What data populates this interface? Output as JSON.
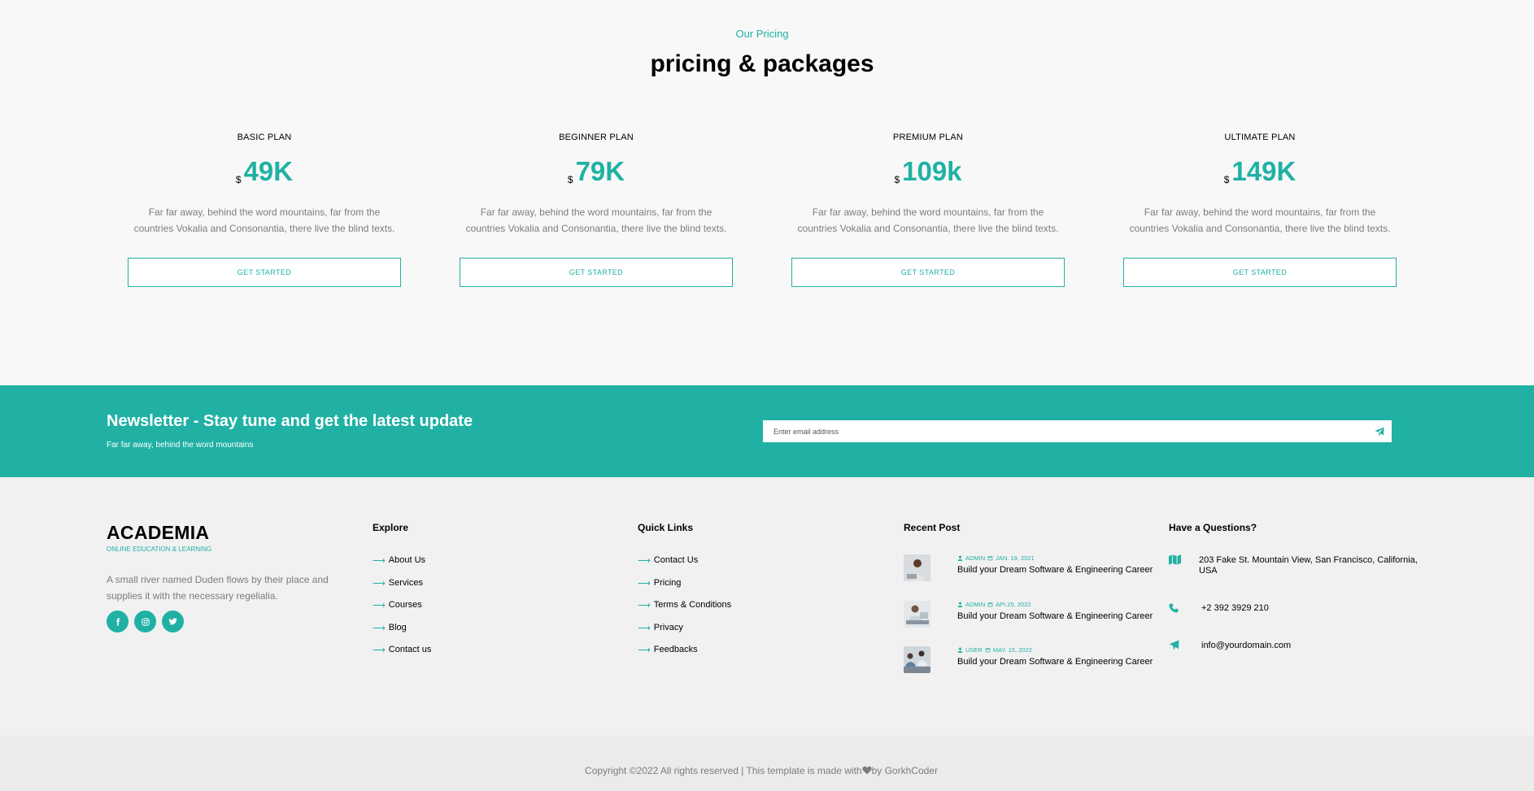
{
  "pricing": {
    "eyebrow": "Our Pricing",
    "title": "pricing & packages",
    "plans": [
      {
        "name": "BASIC PLAN",
        "currency": "$",
        "price": "49K",
        "description": "Far far away, behind the word mountains, far from the countries Vokalia and Consonantia, there live the blind texts.",
        "button": "GET STARTED"
      },
      {
        "name": "BEGINNER PLAN",
        "currency": "$",
        "price": "79K",
        "description": "Far far away, behind the word mountains, far from the countries Vokalia and Consonantia, there live the blind texts.",
        "button": "GET STARTED"
      },
      {
        "name": "PREMIUM PLAN",
        "currency": "$",
        "price": "109k",
        "description": "Far far away, behind the word mountains, far from the countries Vokalia and Consonantia, there live the blind texts.",
        "button": "GET STARTED"
      },
      {
        "name": "ULTIMATE PLAN",
        "currency": "$",
        "price": "149K",
        "description": "Far far away, behind the word mountains, far from the countries Vokalia and Consonantia, there live the blind texts.",
        "button": "GET STARTED"
      }
    ]
  },
  "newsletter": {
    "title": "Newsletter - Stay tune and get the latest update",
    "subtitle": "Far far away, behind the word mountains",
    "placeholder": "Enter email address",
    "send_icon": "paper-plane-icon"
  },
  "footer": {
    "brand": "ACADEMIA",
    "tagline": "ONLINE EDUCATION & LEARNING",
    "about": "A small river named Duden flows by their place and supplies it with the necessary regelialia.",
    "socials": [
      "facebook-icon",
      "instagram-icon",
      "twitter-icon"
    ],
    "explore": {
      "heading": "Explore",
      "links": [
        "About Us",
        "Services",
        "Courses",
        "Blog",
        "Contact us"
      ]
    },
    "quick_links": {
      "heading": "Quick Links",
      "links": [
        "Contact Us",
        "Pricing",
        "Terms & Conditions",
        "Privacy",
        "Feedbacks"
      ]
    },
    "recent_posts": {
      "heading": "Recent Post",
      "posts": [
        {
          "author": "ADMIN",
          "date": "JAN. 19, 2021",
          "title": "Build your Dream Software & Engineering Career"
        },
        {
          "author": "ADMIN",
          "date": "API.25, 2022",
          "title": "Build your Dream Software & Engineering Career"
        },
        {
          "author": "USER",
          "date": "MAY. 15, 2022",
          "title": "Build your Dream Software & Engineering Career"
        }
      ]
    },
    "questions": {
      "heading": "Have a Questions?",
      "address": "203 Fake St. Mountain View, San Francisco, California, USA",
      "phone": "+2 392 3929 210",
      "email": "info@yourdomain.com"
    }
  },
  "copyright": {
    "before": "Copyright ©2022 All rights reserved | This template is made with",
    "after": "by GorkhCoder"
  },
  "colors": {
    "accent": "#20b1a4",
    "muted_text": "#7c7c7c",
    "footer_bg": "#f1f1f1"
  }
}
